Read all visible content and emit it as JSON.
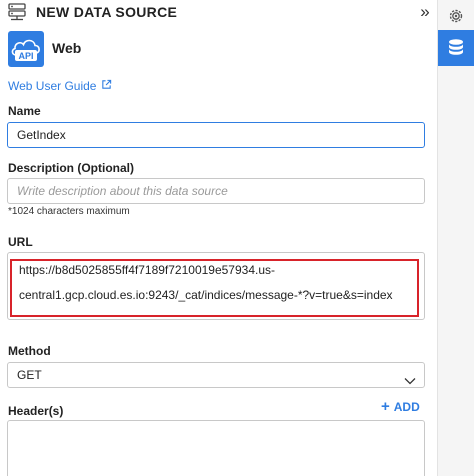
{
  "header": {
    "title": "NEW DATA SOURCE",
    "icon": "data-source-icon",
    "collapse_icon": "double-chevron-right-icon"
  },
  "source": {
    "logo_text": "API",
    "logo_icon": "cloud-api-icon",
    "name": "Web",
    "guide_label": "Web User Guide",
    "guide_icon": "external-link-icon"
  },
  "form": {
    "name_label": "Name",
    "name_value": "GetIndex",
    "description_label": "Description (Optional)",
    "description_placeholder": "Write description about this data source",
    "description_hint": "*1024 characters maximum",
    "url_label": "URL",
    "url_line1": "https://b8d5025855ff4f7189f7210019e57934.us-",
    "url_line2": "central1.gcp.cloud.es.io:9243/_cat/indices/message-*?v=true&s=index",
    "method_label": "Method",
    "method_value": "GET",
    "headers_label": "Header(s)",
    "add_label": "ADD"
  },
  "rail": {
    "settings_icon": "gear-icon",
    "active_icon": "database-icon"
  },
  "colors": {
    "accent": "#2f7de1",
    "highlight": "#d8232a"
  }
}
